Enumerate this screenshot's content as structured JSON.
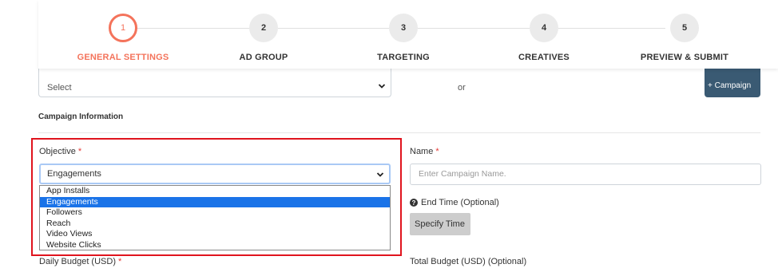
{
  "stepper": {
    "steps": [
      {
        "number": "1",
        "label": "GENERAL SETTINGS"
      },
      {
        "number": "2",
        "label": "AD GROUP"
      },
      {
        "number": "3",
        "label": "TARGETING"
      },
      {
        "number": "4",
        "label": "CREATIVES"
      },
      {
        "number": "5",
        "label": "PREVIEW & SUBMIT"
      }
    ],
    "active_step": "1",
    "active_color": "#f4735b"
  },
  "campaign_select": {
    "value": "Select"
  },
  "or_label": "or",
  "add_campaign_button": "+ Campaign",
  "section": {
    "title": "Campaign Information"
  },
  "objective": {
    "label": "Objective",
    "required_mark": "*",
    "selected": "Engagements",
    "options": [
      "App Installs",
      "Engagements",
      "Followers",
      "Reach",
      "Video Views",
      "Website Clicks"
    ]
  },
  "name": {
    "label": "Name",
    "required_mark": "*",
    "placeholder": "Enter Campaign Name."
  },
  "end_time": {
    "icon": "question-circle-icon",
    "label": "End Time (Optional)",
    "button": "Specify Time"
  },
  "daily_budget": {
    "label": "Daily Budget (USD)",
    "required_mark": "*"
  },
  "total_budget": {
    "label": "Total Budget (USD) (Optional)"
  },
  "highlight_color": "#e0141e",
  "option_highlight_color": "#1a73e8"
}
